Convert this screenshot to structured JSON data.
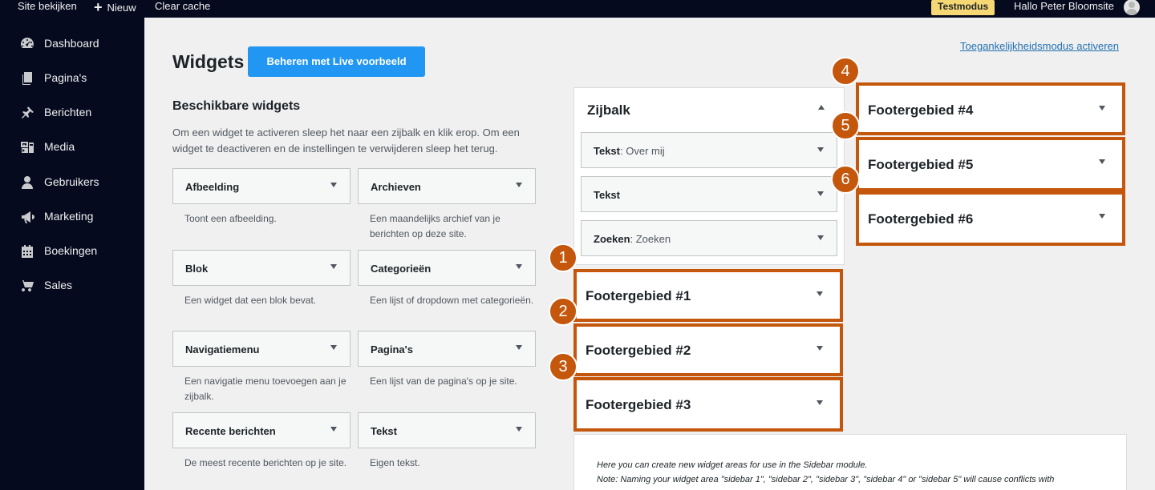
{
  "admin_bar": {
    "site_view": "Site bekijken",
    "new": "Nieuw",
    "clear_cache": "Clear cache",
    "test_mode": "Testmodus",
    "greeting": "Hallo Peter Bloomsite"
  },
  "sidebar": {
    "items": [
      {
        "label": "Dashboard",
        "icon": "dashboard-icon"
      },
      {
        "label": "Pagina's",
        "icon": "pages-icon"
      },
      {
        "label": "Berichten",
        "icon": "pin-icon"
      },
      {
        "label": "Media",
        "icon": "media-icon"
      },
      {
        "label": "Gebruikers",
        "icon": "user-icon"
      },
      {
        "label": "Marketing",
        "icon": "megaphone-icon"
      },
      {
        "label": "Boekingen",
        "icon": "calendar-icon"
      },
      {
        "label": "Sales",
        "icon": "cart-icon"
      }
    ]
  },
  "header": {
    "title": "Widgets",
    "live_button": "Beheren met Live voorbeeld",
    "accessibility_link": "Toegankelijkheidsmodus activeren"
  },
  "available": {
    "title": "Beschikbare widgets",
    "description": "Om een widget te activeren sleep het naar een zijbalk en klik erop. Om een widget te deactiveren en de instellingen te verwijderen sleep het terug.",
    "widgets": [
      {
        "name": "Afbeelding",
        "desc": "Toont een afbeelding."
      },
      {
        "name": "Archieven",
        "desc": "Een maandelijks archief van je berichten op deze site."
      },
      {
        "name": "Blok",
        "desc": "Een widget dat een blok bevat."
      },
      {
        "name": "Categorieën",
        "desc": "Een lijst of dropdown met categorieën."
      },
      {
        "name": "Navigatiemenu",
        "desc": "Een navigatie menu toevoegen aan je zijbalk."
      },
      {
        "name": "Pagina's",
        "desc": "Een lijst van de pagina's op je site."
      },
      {
        "name": "Recente berichten",
        "desc": "De meest recente berichten op je site."
      },
      {
        "name": "Tekst",
        "desc": "Eigen tekst."
      }
    ]
  },
  "zijbalk": {
    "title": "Zijbalk",
    "widgets": [
      {
        "name": "Tekst",
        "sub": ": Over mij"
      },
      {
        "name": "Tekst",
        "sub": ""
      },
      {
        "name": "Zoeken",
        "sub": ": Zoeken"
      }
    ]
  },
  "footer_areas": [
    {
      "title": "Footergebied #1",
      "badge": "1"
    },
    {
      "title": "Footergebied #2",
      "badge": "2"
    },
    {
      "title": "Footergebied #3",
      "badge": "3"
    },
    {
      "title": "Footergebied #4",
      "badge": "4"
    },
    {
      "title": "Footergebied #5",
      "badge": "5"
    },
    {
      "title": "Footergebied #6",
      "badge": "6"
    }
  ],
  "note": {
    "line1": "Here you can create new widget areas for use in the Sidebar module.",
    "line2": "Note: Naming your widget area \"sidebar 1\", \"sidebar 2\", \"sidebar 3\", \"sidebar 4\" or \"sidebar 5\" will cause conflicts with"
  },
  "colors": {
    "admin_dark": "#050a1e",
    "accent_blue": "#2196f3",
    "highlight_orange": "#c4570c",
    "test_badge": "#f5d774"
  }
}
